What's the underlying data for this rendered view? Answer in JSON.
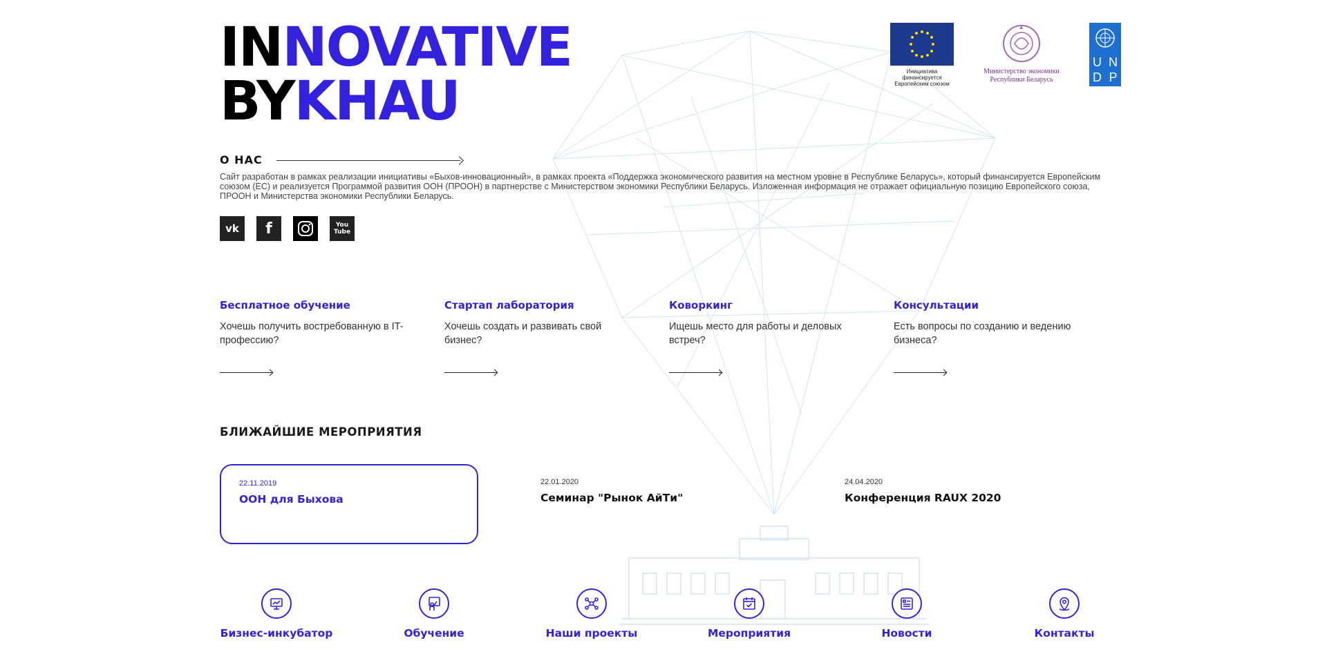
{
  "brand": {
    "line1_black": "IN",
    "line1_blue": "NOVATIVE",
    "line2_black": "BY",
    "line2_blue": "KHAU"
  },
  "partners": {
    "eu_caption": "Инициатива финансируется Европейским союзом",
    "ministry_caption_1": "Министерство экономики",
    "ministry_caption_2": "Республики Беларусь",
    "undp_letters": [
      "U",
      "N",
      "D",
      "P"
    ]
  },
  "about": {
    "title": "О НАС",
    "text": "Сайт разработан в рамках реализации инициативы «Быхов-инновационный», в рамках проекта «Поддержка экономического развития на местном уровне в Республике Беларусь», который финансируется Европейским союзом (ЕС) и реализуется Программой развития ООН (ПРООН) в партнерстве с Министерством экономики Республики Беларусь. Изложенная информация не отражает официальную позицию Европейского союза, ПРООН и Министерства экономики Республики Беларусь."
  },
  "social": [
    {
      "name": "vk-icon",
      "glyph": "vk"
    },
    {
      "name": "facebook-icon",
      "glyph": "f"
    },
    {
      "name": "instagram-icon",
      "glyph": ""
    },
    {
      "name": "youtube-icon",
      "glyph": "You Tube"
    }
  ],
  "services": [
    {
      "title": "Бесплатное обучение",
      "desc": "Хочешь получить востребованную в IT-профессию?"
    },
    {
      "title": "Стартап лаборатория",
      "desc": "Хочешь создать и развивать свой бизнес?"
    },
    {
      "title": "Коворкинг",
      "desc": "Ищешь место для работы и деловых встреч?"
    },
    {
      "title": "Консультации",
      "desc": "Есть вопросы по созданию и ведению бизнеса?"
    }
  ],
  "events": {
    "title": "БЛИЖАЙШИЕ МЕРОПРИЯТИЯ",
    "items": [
      {
        "date": "22.11.2019",
        "name": "ООН для Быхова",
        "active": true
      },
      {
        "date": "22.01.2020",
        "name": "Семинар \"Рынок АйТи\"",
        "active": false
      },
      {
        "date": "24.04.2020",
        "name": "Конференция RAUX 2020",
        "active": false
      }
    ]
  },
  "nav": [
    {
      "label": "Бизнес-инкубатор",
      "icon": "presentation-icon"
    },
    {
      "label": "Обучение",
      "icon": "teacher-icon"
    },
    {
      "label": "Наши проекты",
      "icon": "network-icon"
    },
    {
      "label": "Мероприятия",
      "icon": "calendar-icon"
    },
    {
      "label": "Новости",
      "icon": "news-icon"
    },
    {
      "label": "Контакты",
      "icon": "location-pin-icon"
    }
  ],
  "colors": {
    "accent": "#3322dd",
    "text": "#1a1a1a",
    "eu_blue": "#1e3a8c",
    "undp_blue": "#1f6fd1",
    "ministry_purple": "#7a3090"
  }
}
